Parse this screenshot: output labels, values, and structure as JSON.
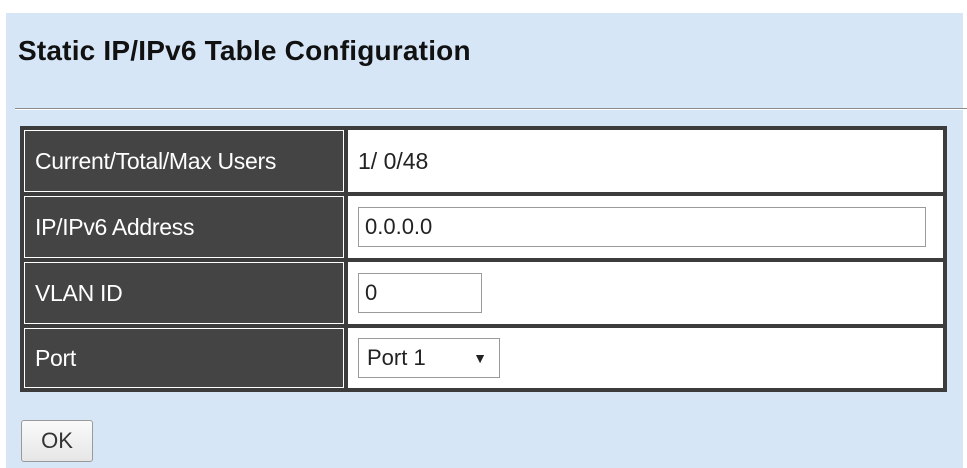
{
  "page": {
    "title": "Static IP/IPv6 Table Configuration"
  },
  "table": {
    "rows": [
      {
        "label": "Current/Total/Max Users",
        "value": "1/ 0/48"
      },
      {
        "label": "IP/IPv6 Address",
        "value": "0.0.0.0"
      },
      {
        "label": "VLAN ID",
        "value": "0"
      },
      {
        "label": "Port",
        "value": "Port 1"
      }
    ]
  },
  "icons": {
    "port_select_caret": "dropdown-caret-icon"
  },
  "actions": {
    "ok_label": "OK"
  },
  "colors": {
    "panel_background": "#d6e6f7",
    "label_cell_background": "#444444",
    "table_border": "#3c3c3c"
  }
}
